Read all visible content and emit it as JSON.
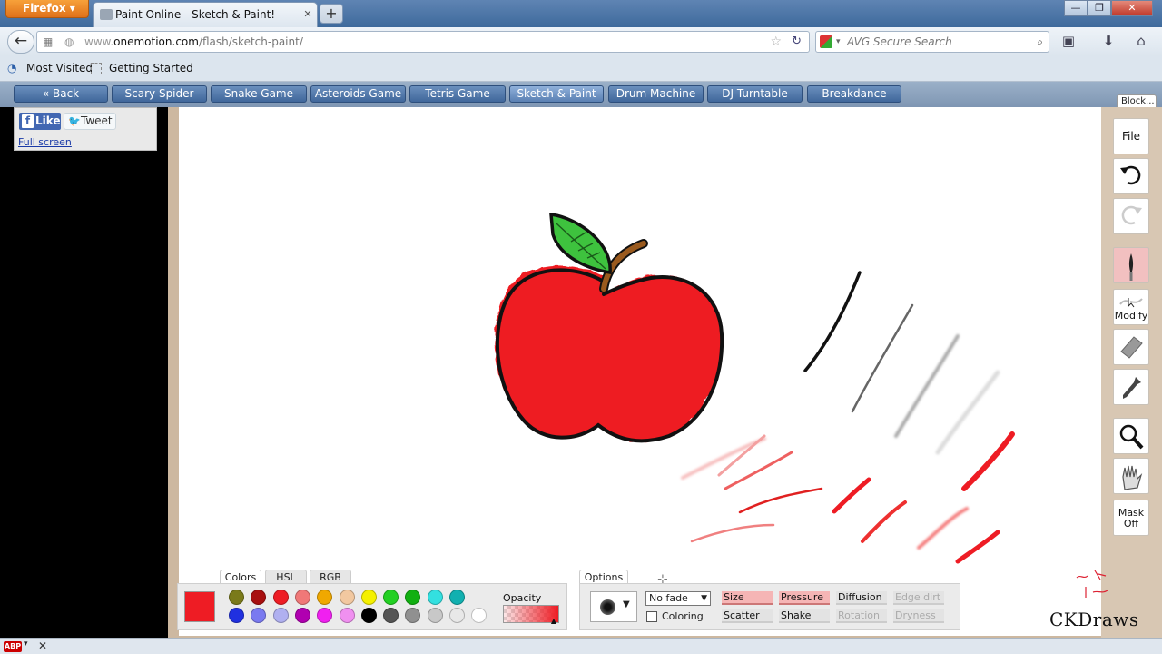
{
  "browser": {
    "menu_button": "Firefox",
    "tab_title": "Paint Online - Sketch & Paint!",
    "new_tab": "+",
    "url_host": "www.",
    "url_domain": "onemotion.com",
    "url_path": "/flash/sketch-paint/",
    "search_placeholder": "AVG Secure Search",
    "window_controls": [
      "—",
      "❐",
      "✕"
    ]
  },
  "bookmarks": [
    "Most Visited",
    "Getting Started"
  ],
  "site_menu": [
    "« Back",
    "Scary Spider",
    "Snake Game",
    "Asteroids Game",
    "Tetris Game",
    "Sketch & Paint",
    "Drum Machine",
    "DJ Turntable",
    "Breakdance"
  ],
  "site_menu_active": "Sketch & Paint",
  "social": {
    "like": "Like",
    "tweet": "Tweet",
    "fullscreen": "Full screen"
  },
  "block_tab": "Block...",
  "tools": {
    "file": "File",
    "modify": "Modify",
    "mask": "Mask Off",
    "icons": [
      "undo-icon",
      "redo-icon",
      "brush-icon",
      "modify-icon",
      "eraser-icon",
      "eyedropper-icon",
      "magnifier-icon",
      "hand-icon"
    ]
  },
  "palette": {
    "tabs": [
      "Colors",
      "HSL",
      "RGB"
    ],
    "current_color": "#ee1c24",
    "opacity_label": "Opacity",
    "row1": [
      "#7a7a1a",
      "#a80f0f",
      "#ee1c24",
      "#f07878",
      "#f0a800",
      "#f2c8a0",
      "#f5f000",
      "#22d022",
      "#11b011",
      "#33e0e0",
      "#11b0b0"
    ],
    "row2": [
      "#2030e0",
      "#7a7af0",
      "#b0b0f0",
      "#b000b0",
      "#f020f0",
      "#f090f0",
      "#000000",
      "#555555",
      "#909090",
      "#c8c8c8",
      "#e8e8e8",
      "#ffffff"
    ]
  },
  "options": {
    "tab": "Options",
    "fade": "No fade",
    "coloring": "Coloring",
    "buttons": [
      {
        "label": "Size",
        "state": "on"
      },
      {
        "label": "Pressure",
        "state": "on"
      },
      {
        "label": "Diffusion",
        "state": "normal"
      },
      {
        "label": "Edge dirt",
        "state": "dim"
      },
      {
        "label": "Scatter",
        "state": "normal"
      },
      {
        "label": "Shake",
        "state": "normal"
      },
      {
        "label": "Rotation",
        "state": "dim"
      },
      {
        "label": "Dryness",
        "state": "dim"
      }
    ]
  },
  "watermark": "CKDraws",
  "statusbar": {
    "abp": "ABP",
    "close": "✕"
  }
}
